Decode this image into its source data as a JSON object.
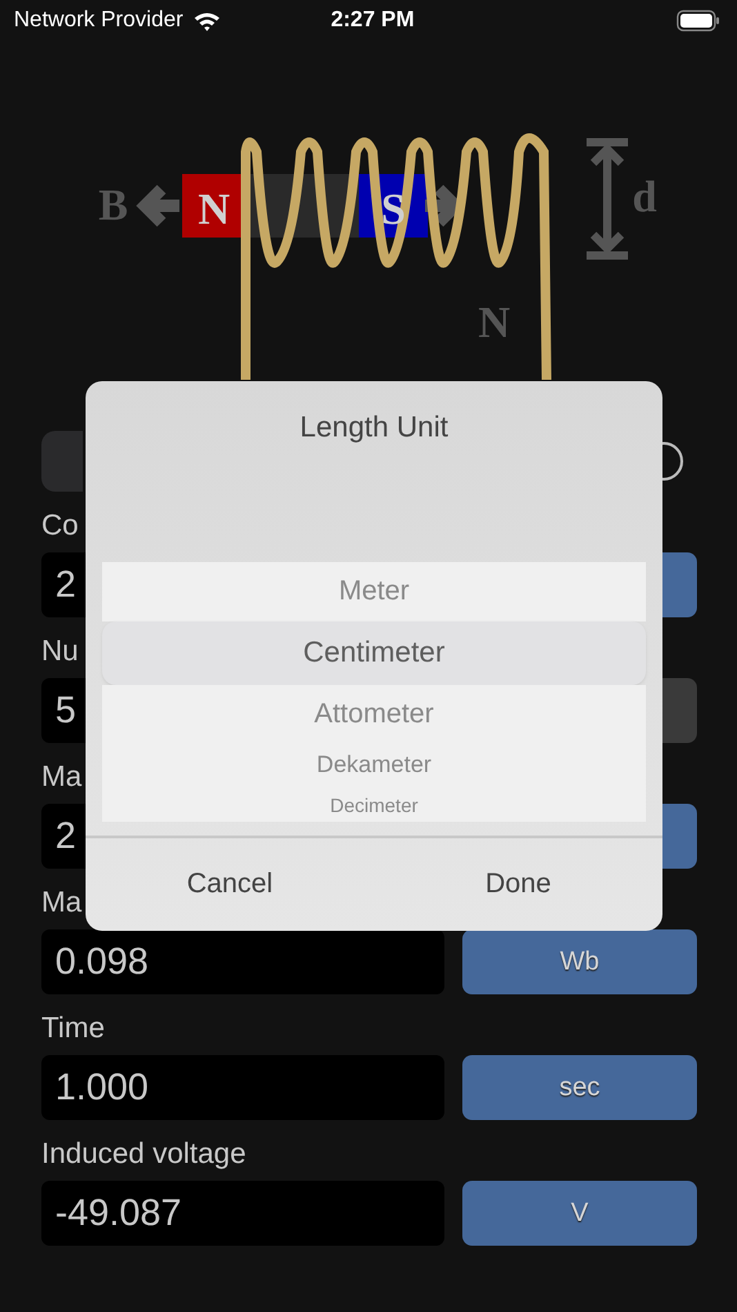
{
  "status_bar": {
    "carrier": "Network Provider",
    "time": "2:27 PM"
  },
  "diagram": {
    "field_label": "B",
    "magnet_north": "N",
    "magnet_south": "S",
    "distance_label": "d",
    "turns_label": "N"
  },
  "fields": [
    {
      "label": "Co",
      "value": "2",
      "unit_button": {
        "disabled": false
      }
    },
    {
      "label": "Nu",
      "value": "5",
      "unit_button": {
        "disabled": true
      }
    },
    {
      "label": "Ma",
      "value": "2",
      "unit_button": {
        "disabled": false
      }
    },
    {
      "label": "Ma",
      "value": "0.098",
      "unit_button": {
        "label": "Wb",
        "disabled": false
      }
    },
    {
      "label": "Time",
      "value": "1.000",
      "unit_button": {
        "label": "sec",
        "disabled": false
      }
    },
    {
      "label": "Induced voltage",
      "value": "-49.087",
      "unit_button": {
        "label": "V",
        "disabled": false
      }
    }
  ],
  "dialog": {
    "title": "Length Unit",
    "options": [
      {
        "label": "Meter",
        "selected": false
      },
      {
        "label": "Centimeter",
        "selected": true
      },
      {
        "label": "Attometer",
        "selected": false
      },
      {
        "label": "Dekameter",
        "selected": false
      },
      {
        "label": "Decimeter",
        "selected": false
      }
    ],
    "buttons": [
      "Cancel",
      "Done"
    ]
  }
}
